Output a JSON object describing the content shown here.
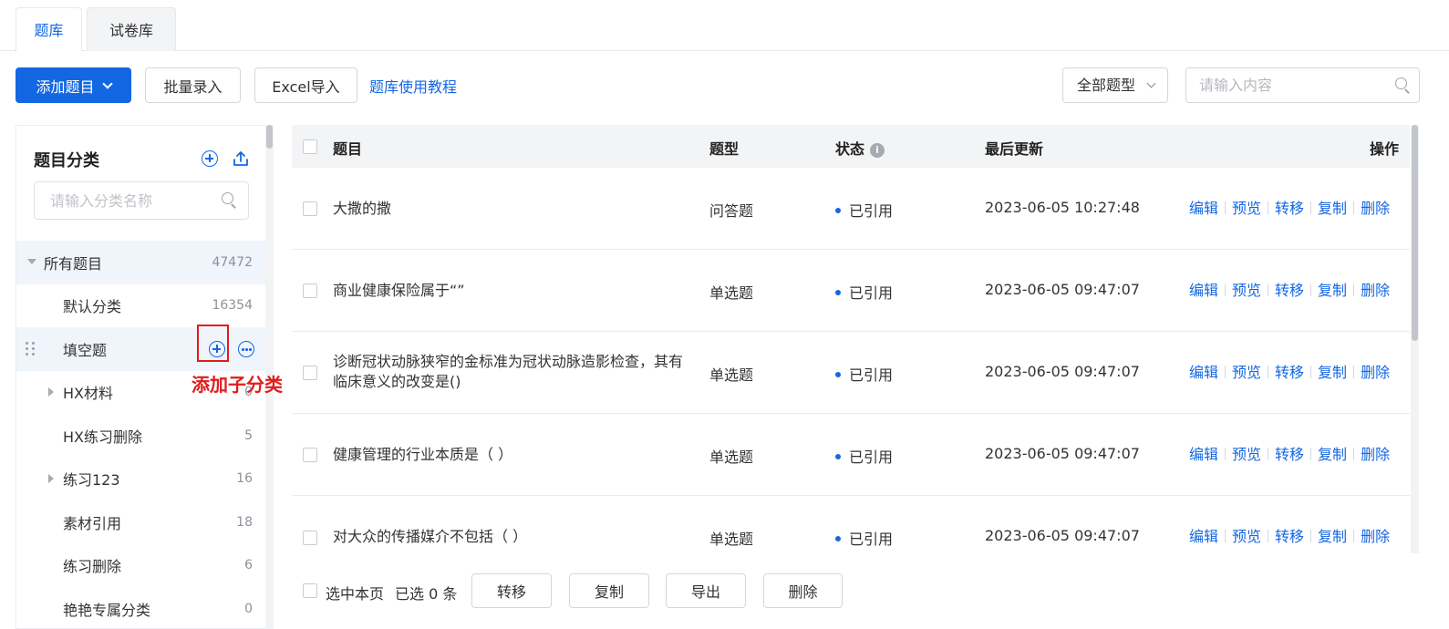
{
  "tabs": [
    {
      "label": "题库",
      "active": true
    },
    {
      "label": "试卷库",
      "active": false
    }
  ],
  "toolbar": {
    "add_label": "添加题目",
    "batch_label": "批量录入",
    "excel_label": "Excel导入",
    "tutorial_label": "题库使用教程",
    "type_select": "全部题型",
    "search_placeholder": "请输入内容",
    "accent_color": "#1467e2"
  },
  "sidebar": {
    "title": "题目分类",
    "search_placeholder": "请输入分类名称",
    "items": [
      {
        "label": "所有题目",
        "count": "47472"
      },
      {
        "label": "默认分类",
        "count": "16354"
      },
      {
        "label": "填空题",
        "count": ""
      },
      {
        "label": "HX材料",
        "count": "0"
      },
      {
        "label": "HX练习删除",
        "count": "5"
      },
      {
        "label": "练习123",
        "count": "16"
      },
      {
        "label": "素材引用",
        "count": "18"
      },
      {
        "label": "练习删除",
        "count": "6"
      },
      {
        "label": "艳艳专属分类",
        "count": "0"
      }
    ],
    "annotation": "添加子分类",
    "annotation_color": "#e11b1b"
  },
  "table": {
    "headers": {
      "title": "题目",
      "type": "题型",
      "status": "状态",
      "updated": "最后更新",
      "ops": "操作"
    },
    "ops": [
      "编辑",
      "预览",
      "转移",
      "复制",
      "删除"
    ],
    "rows": [
      {
        "title": "大撒的撒",
        "type": "问答题",
        "status": "已引用",
        "updated": "2023-06-05 10:27:48"
      },
      {
        "title": "商业健康保险属于“”",
        "type": "单选题",
        "status": "已引用",
        "updated": "2023-06-05 09:47:07"
      },
      {
        "title": "诊断冠状动脉狭窄的金标准为冠状动脉造影检查，其有临床意义的改变是()",
        "type": "单选题",
        "status": "已引用",
        "updated": "2023-06-05 09:47:07"
      },
      {
        "title": "健康管理的行业本质是（ ）",
        "type": "单选题",
        "status": "已引用",
        "updated": "2023-06-05 09:47:07"
      },
      {
        "title": "对大众的传播媒介不包括（ ）",
        "type": "单选题",
        "status": "已引用",
        "updated": "2023-06-05 09:47:07"
      }
    ]
  },
  "footer": {
    "select_page": "选中本页",
    "selected_text": "已选 0 条",
    "transfer": "转移",
    "copy": "复制",
    "export": "导出",
    "delete": "删除"
  }
}
